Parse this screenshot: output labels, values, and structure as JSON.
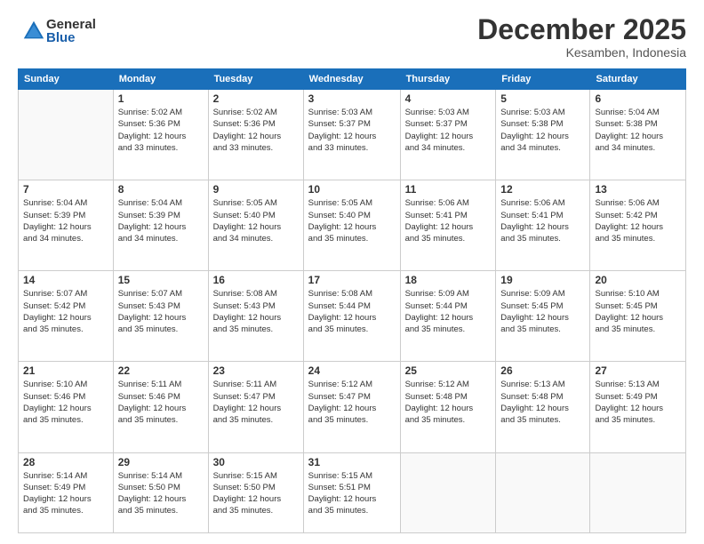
{
  "logo": {
    "general": "General",
    "blue": "Blue"
  },
  "title": "December 2025",
  "location": "Kesamben, Indonesia",
  "days_header": [
    "Sunday",
    "Monday",
    "Tuesday",
    "Wednesday",
    "Thursday",
    "Friday",
    "Saturday"
  ],
  "weeks": [
    [
      {
        "num": "",
        "info": ""
      },
      {
        "num": "1",
        "info": "Sunrise: 5:02 AM\nSunset: 5:36 PM\nDaylight: 12 hours\nand 33 minutes."
      },
      {
        "num": "2",
        "info": "Sunrise: 5:02 AM\nSunset: 5:36 PM\nDaylight: 12 hours\nand 33 minutes."
      },
      {
        "num": "3",
        "info": "Sunrise: 5:03 AM\nSunset: 5:37 PM\nDaylight: 12 hours\nand 33 minutes."
      },
      {
        "num": "4",
        "info": "Sunrise: 5:03 AM\nSunset: 5:37 PM\nDaylight: 12 hours\nand 34 minutes."
      },
      {
        "num": "5",
        "info": "Sunrise: 5:03 AM\nSunset: 5:38 PM\nDaylight: 12 hours\nand 34 minutes."
      },
      {
        "num": "6",
        "info": "Sunrise: 5:04 AM\nSunset: 5:38 PM\nDaylight: 12 hours\nand 34 minutes."
      }
    ],
    [
      {
        "num": "7",
        "info": "Sunrise: 5:04 AM\nSunset: 5:39 PM\nDaylight: 12 hours\nand 34 minutes."
      },
      {
        "num": "8",
        "info": "Sunrise: 5:04 AM\nSunset: 5:39 PM\nDaylight: 12 hours\nand 34 minutes."
      },
      {
        "num": "9",
        "info": "Sunrise: 5:05 AM\nSunset: 5:40 PM\nDaylight: 12 hours\nand 34 minutes."
      },
      {
        "num": "10",
        "info": "Sunrise: 5:05 AM\nSunset: 5:40 PM\nDaylight: 12 hours\nand 35 minutes."
      },
      {
        "num": "11",
        "info": "Sunrise: 5:06 AM\nSunset: 5:41 PM\nDaylight: 12 hours\nand 35 minutes."
      },
      {
        "num": "12",
        "info": "Sunrise: 5:06 AM\nSunset: 5:41 PM\nDaylight: 12 hours\nand 35 minutes."
      },
      {
        "num": "13",
        "info": "Sunrise: 5:06 AM\nSunset: 5:42 PM\nDaylight: 12 hours\nand 35 minutes."
      }
    ],
    [
      {
        "num": "14",
        "info": "Sunrise: 5:07 AM\nSunset: 5:42 PM\nDaylight: 12 hours\nand 35 minutes."
      },
      {
        "num": "15",
        "info": "Sunrise: 5:07 AM\nSunset: 5:43 PM\nDaylight: 12 hours\nand 35 minutes."
      },
      {
        "num": "16",
        "info": "Sunrise: 5:08 AM\nSunset: 5:43 PM\nDaylight: 12 hours\nand 35 minutes."
      },
      {
        "num": "17",
        "info": "Sunrise: 5:08 AM\nSunset: 5:44 PM\nDaylight: 12 hours\nand 35 minutes."
      },
      {
        "num": "18",
        "info": "Sunrise: 5:09 AM\nSunset: 5:44 PM\nDaylight: 12 hours\nand 35 minutes."
      },
      {
        "num": "19",
        "info": "Sunrise: 5:09 AM\nSunset: 5:45 PM\nDaylight: 12 hours\nand 35 minutes."
      },
      {
        "num": "20",
        "info": "Sunrise: 5:10 AM\nSunset: 5:45 PM\nDaylight: 12 hours\nand 35 minutes."
      }
    ],
    [
      {
        "num": "21",
        "info": "Sunrise: 5:10 AM\nSunset: 5:46 PM\nDaylight: 12 hours\nand 35 minutes."
      },
      {
        "num": "22",
        "info": "Sunrise: 5:11 AM\nSunset: 5:46 PM\nDaylight: 12 hours\nand 35 minutes."
      },
      {
        "num": "23",
        "info": "Sunrise: 5:11 AM\nSunset: 5:47 PM\nDaylight: 12 hours\nand 35 minutes."
      },
      {
        "num": "24",
        "info": "Sunrise: 5:12 AM\nSunset: 5:47 PM\nDaylight: 12 hours\nand 35 minutes."
      },
      {
        "num": "25",
        "info": "Sunrise: 5:12 AM\nSunset: 5:48 PM\nDaylight: 12 hours\nand 35 minutes."
      },
      {
        "num": "26",
        "info": "Sunrise: 5:13 AM\nSunset: 5:48 PM\nDaylight: 12 hours\nand 35 minutes."
      },
      {
        "num": "27",
        "info": "Sunrise: 5:13 AM\nSunset: 5:49 PM\nDaylight: 12 hours\nand 35 minutes."
      }
    ],
    [
      {
        "num": "28",
        "info": "Sunrise: 5:14 AM\nSunset: 5:49 PM\nDaylight: 12 hours\nand 35 minutes."
      },
      {
        "num": "29",
        "info": "Sunrise: 5:14 AM\nSunset: 5:50 PM\nDaylight: 12 hours\nand 35 minutes."
      },
      {
        "num": "30",
        "info": "Sunrise: 5:15 AM\nSunset: 5:50 PM\nDaylight: 12 hours\nand 35 minutes."
      },
      {
        "num": "31",
        "info": "Sunrise: 5:15 AM\nSunset: 5:51 PM\nDaylight: 12 hours\nand 35 minutes."
      },
      {
        "num": "",
        "info": ""
      },
      {
        "num": "",
        "info": ""
      },
      {
        "num": "",
        "info": ""
      }
    ]
  ]
}
